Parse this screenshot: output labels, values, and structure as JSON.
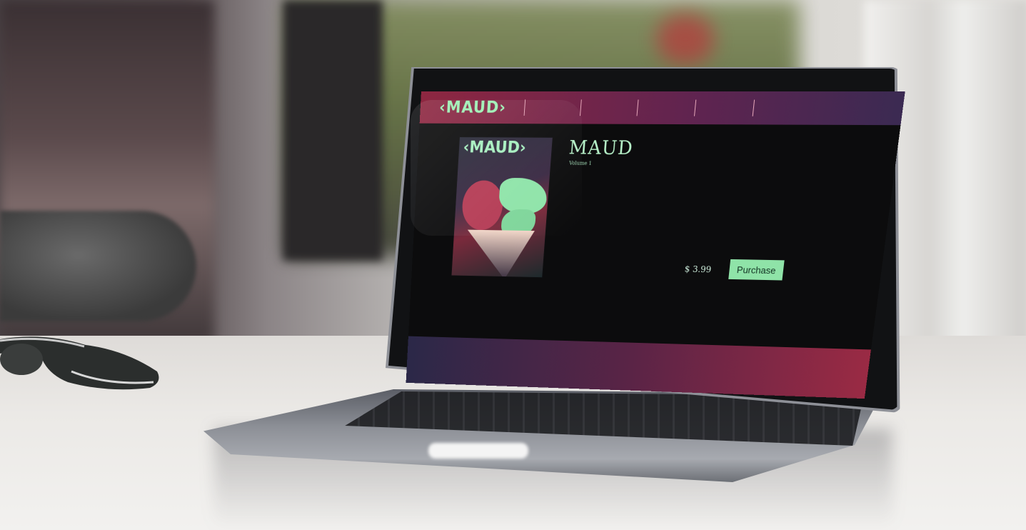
{
  "site": {
    "logo": "‹MAUD›",
    "nav": [
      "",
      "",
      "",
      ""
    ],
    "product": {
      "cover_logo": "‹MAUD›",
      "title": "MAUD",
      "subtitle": "Volume 1",
      "price": "$ 3.99",
      "purchase_label": "Purchase"
    },
    "footer": [
      "",
      "",
      "",
      ""
    ]
  },
  "colors": {
    "accent_green": "#8fe3a8",
    "nav_magenta": "#8e2741",
    "footer_red": "#9a2a44",
    "screen_bg": "#0c0c0d"
  }
}
